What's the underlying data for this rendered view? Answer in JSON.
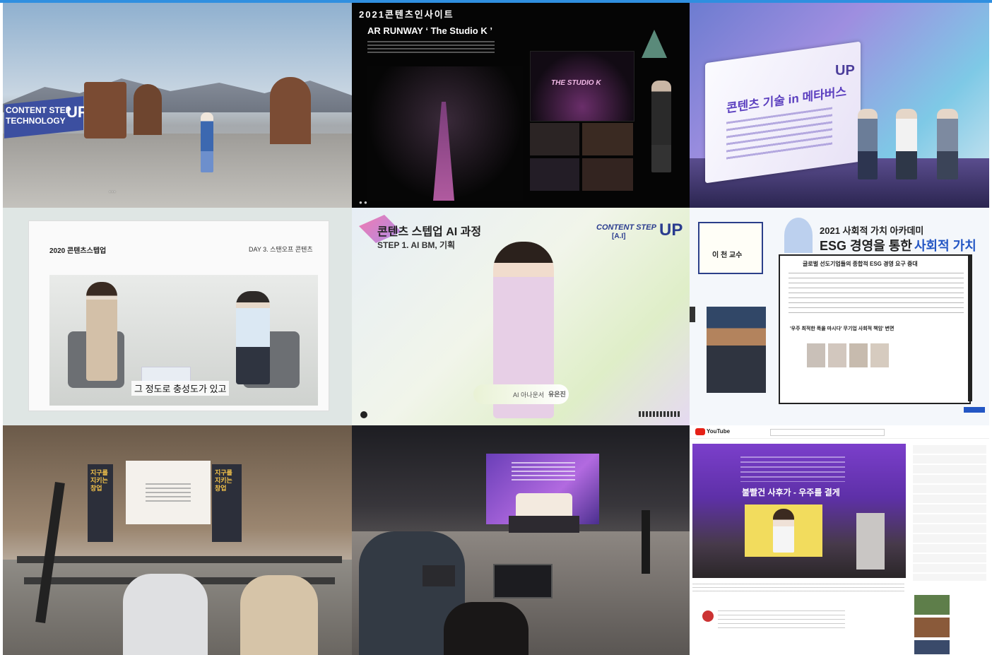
{
  "tile1": {
    "logo_line1": "CONTENT STEP",
    "logo_line2": "TECHNOLOGY",
    "logo_up": "UP"
  },
  "tile2": {
    "header": "2021콘텐츠인사이트",
    "title": "AR RUNWAY ‘ The Studio K ’",
    "studio_sign": "THE STUDIO K"
  },
  "tile3": {
    "screen_title": "콘텐츠 기술 in 메타버스",
    "logo_up": "UP"
  },
  "tile4": {
    "program": "2020 콘텐츠스텝업",
    "day": "DAY 3. 스탠오프 콘텐츠",
    "caption": "그 정도로 충성도가 있고"
  },
  "tile5": {
    "title": "콘텐츠 스텝업 AI 과정",
    "subtitle": "STEP 1. AI BM, 기획",
    "logo": "CONTENT STEP",
    "logo_ai": "[A.I]",
    "logo_up": "UP",
    "nameplate_role": "AI 아나운서",
    "nameplate_name": "유은진"
  },
  "tile6": {
    "academy": "2021 사회적 가치 아카데미",
    "headline_part1": "ESG 경영을 통한",
    "headline_part2": "사회적 가치 창출",
    "speaker": "이 천 교수",
    "bullet": "글로벌 선도기업들의 종합적 ESG 경영 요구 증대",
    "quote": "'우주 최적한 폭을 마시다' 무기업 사회적 책임' 변면"
  },
  "tile7": {
    "banner_left": "지구를 지키는 창업",
    "banner_right": "지구를 지키는 창업"
  },
  "tile8": {},
  "tile9": {
    "logo": "YouTube",
    "video_title": "불빨건 사후가 - 우주를 결게"
  },
  "colors": {
    "topbar": "#2f8fe0",
    "accent_pink": "#e0286f",
    "accent_blue": "#2356c4"
  }
}
